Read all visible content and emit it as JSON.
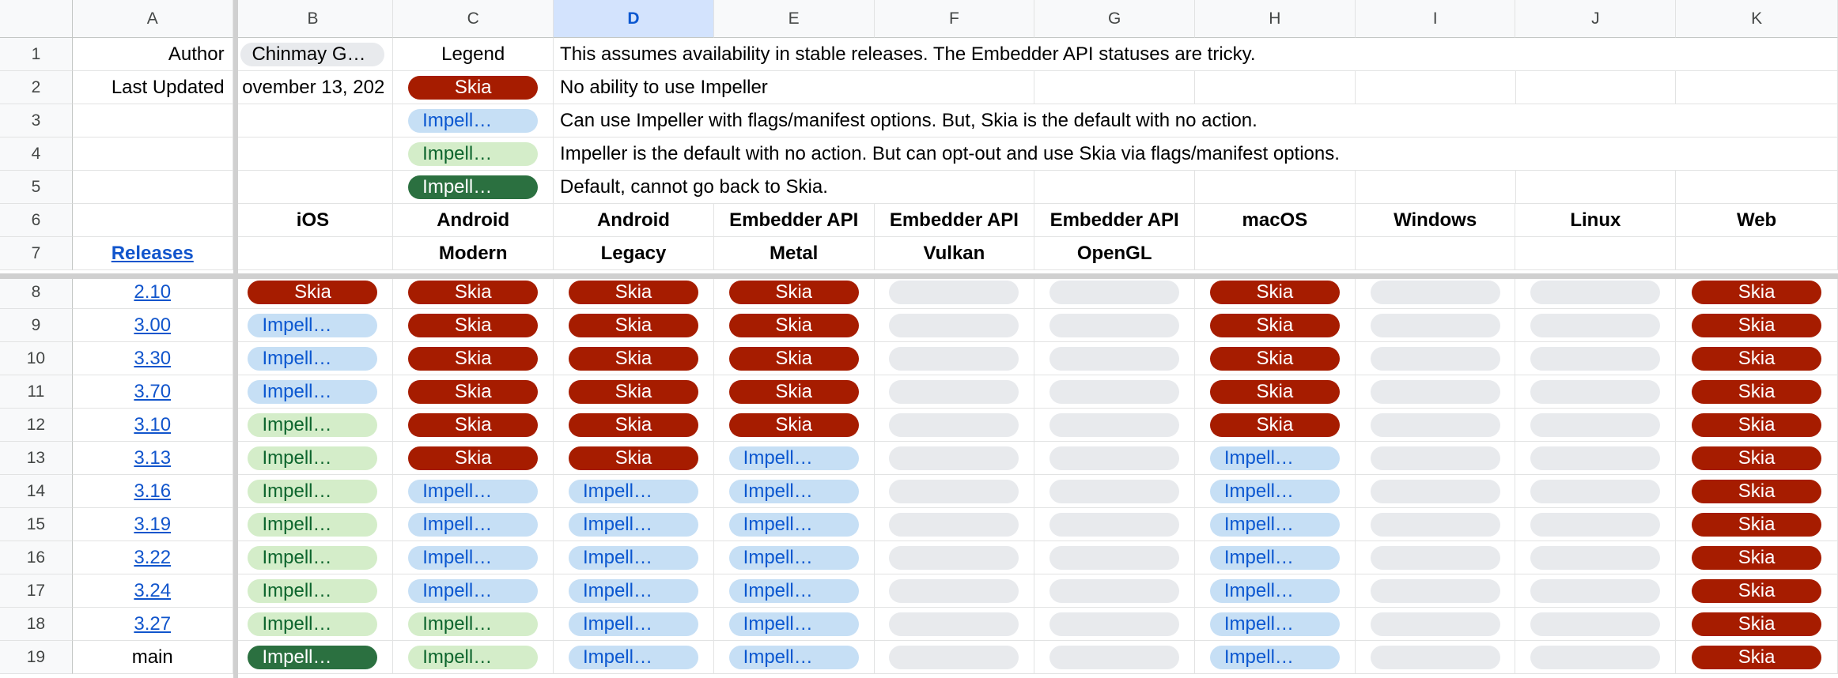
{
  "columns": [
    "A",
    "B",
    "C",
    "D",
    "E",
    "F",
    "G",
    "H",
    "I",
    "J",
    "K"
  ],
  "selected_column": "D",
  "row_numbers": [
    "1",
    "2",
    "3",
    "4",
    "5",
    "6",
    "7",
    "8",
    "9",
    "10",
    "11",
    "12",
    "13",
    "14",
    "15",
    "16",
    "17",
    "18",
    "19"
  ],
  "author_label": "Author",
  "author_value": "Chinmay G…",
  "last_updated_label": "Last Updated",
  "last_updated_value": "ovember 13, 202",
  "legend_label": "Legend",
  "legend": [
    {
      "chip": "Skia",
      "kind": "skia",
      "desc": "No ability to use Impeller"
    },
    {
      "chip": "Impell…",
      "kind": "opt",
      "desc": "Can use Impeller with flags/manifest options. But, Skia is the default with no action."
    },
    {
      "chip": "Impell…",
      "kind": "dflt",
      "desc": "Impeller is the default with no action. But can opt-out and use Skia via flags/manifest options."
    },
    {
      "chip": "Impell…",
      "kind": "forced",
      "desc": "Default, cannot go back to Skia."
    }
  ],
  "note": "This assumes availability in stable releases. The Embedder API statuses are tricky.",
  "releases_link": "Releases",
  "platform_headers": [
    {
      "top": "iOS",
      "bottom": ""
    },
    {
      "top": "Android",
      "bottom": "Modern"
    },
    {
      "top": "Android",
      "bottom": "Legacy"
    },
    {
      "top": "Embedder API",
      "bottom": "Metal"
    },
    {
      "top": "Embedder API",
      "bottom": "Vulkan"
    },
    {
      "top": "Embedder API",
      "bottom": "OpenGL"
    },
    {
      "top": "macOS",
      "bottom": ""
    },
    {
      "top": "Windows",
      "bottom": ""
    },
    {
      "top": "Linux",
      "bottom": ""
    },
    {
      "top": "Web",
      "bottom": ""
    }
  ],
  "status_labels": {
    "skia": "Skia",
    "opt": "Impell…",
    "dflt": "Impell…",
    "forced": "Impell…",
    "none": ""
  },
  "status_colors": {
    "skia": "#a61c00",
    "opt": "#c6dff5",
    "dflt": "#d4edc9",
    "forced": "#2b7040",
    "none": "#e8eaed"
  },
  "releases": [
    {
      "version": "2.10",
      "is_link": true,
      "statuses": [
        "skia",
        "skia",
        "skia",
        "skia",
        "none",
        "none",
        "skia",
        "none",
        "none",
        "skia"
      ]
    },
    {
      "version": "3.00",
      "is_link": true,
      "statuses": [
        "opt",
        "skia",
        "skia",
        "skia",
        "none",
        "none",
        "skia",
        "none",
        "none",
        "skia"
      ]
    },
    {
      "version": "3.30",
      "is_link": true,
      "statuses": [
        "opt",
        "skia",
        "skia",
        "skia",
        "none",
        "none",
        "skia",
        "none",
        "none",
        "skia"
      ]
    },
    {
      "version": "3.70",
      "is_link": true,
      "statuses": [
        "opt",
        "skia",
        "skia",
        "skia",
        "none",
        "none",
        "skia",
        "none",
        "none",
        "skia"
      ]
    },
    {
      "version": "3.10",
      "is_link": true,
      "statuses": [
        "dflt",
        "skia",
        "skia",
        "skia",
        "none",
        "none",
        "skia",
        "none",
        "none",
        "skia"
      ]
    },
    {
      "version": "3.13",
      "is_link": true,
      "statuses": [
        "dflt",
        "skia",
        "skia",
        "opt",
        "none",
        "none",
        "opt",
        "none",
        "none",
        "skia"
      ]
    },
    {
      "version": "3.16",
      "is_link": true,
      "statuses": [
        "dflt",
        "opt",
        "opt",
        "opt",
        "none",
        "none",
        "opt",
        "none",
        "none",
        "skia"
      ]
    },
    {
      "version": "3.19",
      "is_link": true,
      "statuses": [
        "dflt",
        "opt",
        "opt",
        "opt",
        "none",
        "none",
        "opt",
        "none",
        "none",
        "skia"
      ]
    },
    {
      "version": "3.22",
      "is_link": true,
      "statuses": [
        "dflt",
        "opt",
        "opt",
        "opt",
        "none",
        "none",
        "opt",
        "none",
        "none",
        "skia"
      ]
    },
    {
      "version": "3.24",
      "is_link": true,
      "statuses": [
        "dflt",
        "opt",
        "opt",
        "opt",
        "none",
        "none",
        "opt",
        "none",
        "none",
        "skia"
      ]
    },
    {
      "version": "3.27",
      "is_link": true,
      "statuses": [
        "dflt",
        "dflt",
        "opt",
        "opt",
        "none",
        "none",
        "opt",
        "none",
        "none",
        "skia"
      ]
    },
    {
      "version": "main",
      "is_link": false,
      "statuses": [
        "forced",
        "dflt",
        "opt",
        "opt",
        "none",
        "none",
        "opt",
        "none",
        "none",
        "skia"
      ]
    }
  ]
}
